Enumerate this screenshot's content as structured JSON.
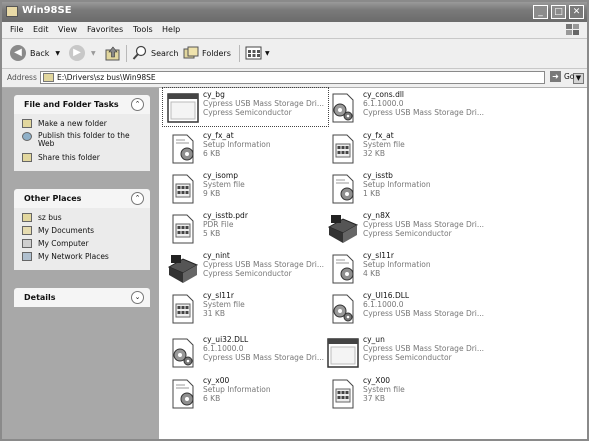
{
  "window": {
    "title": "Win98SE"
  },
  "title_buttons": {
    "minimize": "_",
    "maximize": "□",
    "close": "✕"
  },
  "menu": [
    "File",
    "Edit",
    "View",
    "Favorites",
    "Tools",
    "Help"
  ],
  "toolbar": {
    "back_label": "Back",
    "search_label": "Search",
    "folders_label": "Folders"
  },
  "address": {
    "label": "Address",
    "path": "E:\\Drivers\\sz bus\\Win98SE",
    "go_label": "Go"
  },
  "tasks_panel": {
    "title": "File and Folder Tasks",
    "items": [
      "Make a new folder",
      "Publish this folder to the Web",
      "Share this folder"
    ]
  },
  "places_panel": {
    "title": "Other Places",
    "items": [
      "sz bus",
      "My Documents",
      "My Computer",
      "My Network Places"
    ]
  },
  "details_panel": {
    "title": "Details"
  },
  "files": [
    {
      "name": "cy_bg",
      "type": "Cypress USB Mass Storage Dri...",
      "extra": "Cypress Semiconductor",
      "icon": "window-icon"
    },
    {
      "name": "cy_cons.dll",
      "type": "6.1.1000.0",
      "extra": "Cypress USB Mass Storage Dri...",
      "icon": "dll-icon"
    },
    {
      "name": "cy_fx_at",
      "type": "Setup Information",
      "extra": "6 KB",
      "icon": "inf-icon"
    },
    {
      "name": "cy_fx_at",
      "type": "System file",
      "extra": "32 KB",
      "icon": "sys-icon"
    },
    {
      "name": "cy_isomp",
      "type": "System file",
      "extra": "9 KB",
      "icon": "sys-icon"
    },
    {
      "name": "cy_isstb",
      "type": "Setup Information",
      "extra": "1 KB",
      "icon": "inf-icon"
    },
    {
      "name": "cy_isstb.pdr",
      "type": "PDR File",
      "extra": "5 KB",
      "icon": "sys-icon"
    },
    {
      "name": "cy_n8X",
      "type": "Cypress USB Mass Storage Dri...",
      "extra": "Cypress Semiconductor",
      "icon": "drive-icon"
    },
    {
      "name": "cy_nint",
      "type": "Cypress USB Mass Storage Dri...",
      "extra": "Cypress Semiconductor",
      "icon": "drive-icon"
    },
    {
      "name": "cy_sl11r",
      "type": "Setup Information",
      "extra": "4 KB",
      "icon": "inf-icon"
    },
    {
      "name": "cy_sl11r",
      "type": "System file",
      "extra": "31 KB",
      "icon": "sys-icon"
    },
    {
      "name": "cy_UI16.DLL",
      "type": "6.1.1000.0",
      "extra": "Cypress USB Mass Storage Dri...",
      "icon": "dll-icon"
    },
    {
      "name": "cy_ui32.DLL",
      "type": "6.1.1000.0",
      "extra": "Cypress USB Mass Storage Dri...",
      "icon": "dll-icon"
    },
    {
      "name": "cy_un",
      "type": "Cypress USB Mass Storage Dri...",
      "extra": "Cypress Semiconductor",
      "icon": "window-icon"
    },
    {
      "name": "cy_x00",
      "type": "Setup Information",
      "extra": "6 KB",
      "icon": "inf-icon"
    },
    {
      "name": "cy_X00",
      "type": "System file",
      "extra": "37 KB",
      "icon": "sys-icon"
    }
  ]
}
